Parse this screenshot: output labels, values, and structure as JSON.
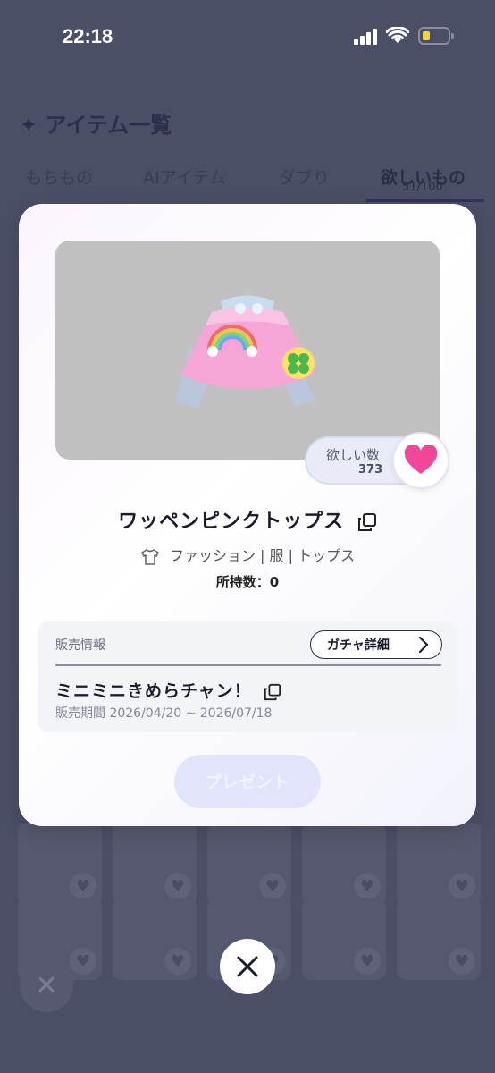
{
  "status_bar": {
    "time": "22:18"
  },
  "background": {
    "title": "✦ アイテム一覧",
    "tabs": [
      {
        "label": "もちもの"
      },
      {
        "label": "AIアイテム"
      },
      {
        "label": "ダブり"
      },
      {
        "label": "欲しいもの",
        "count": "51/100"
      }
    ]
  },
  "modal": {
    "want": {
      "label": "欲しい数",
      "count": "373"
    },
    "item_name": "ワッペンピンクトップス",
    "category": "ファッション | 服 | トップス",
    "owned": "所持数：0",
    "sales": {
      "label": "販売情報",
      "gacha_button": "ガチャ詳細",
      "gacha_name": "ミニミニきめらチャン！",
      "period": "販売期間 2026/04/20 ~ 2026/07/18"
    },
    "present_button": "プレゼント"
  },
  "colors": {
    "heart": "#f0479a",
    "accent": "#30335a"
  }
}
